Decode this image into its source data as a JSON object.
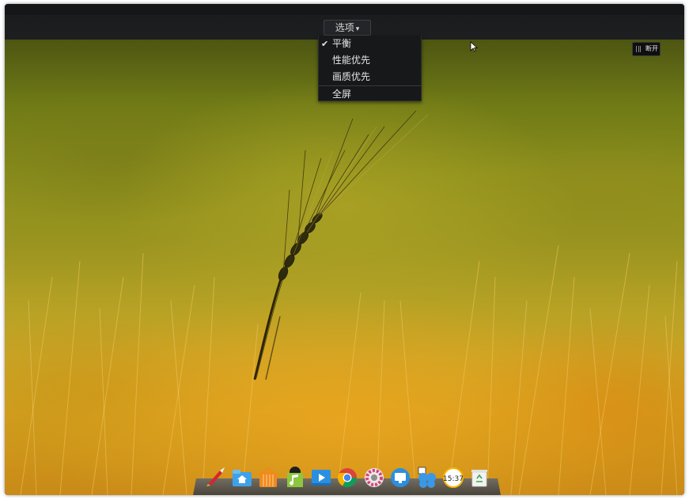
{
  "toolbar": {
    "options_label": "选项",
    "options_caret": "▾"
  },
  "options_menu": {
    "items": [
      {
        "label": "平衡",
        "checked": true
      },
      {
        "label": "性能优先",
        "checked": false
      },
      {
        "label": "画质优先",
        "checked": false
      }
    ],
    "fullscreen_label": "全屏",
    "check_glyph": "✔"
  },
  "disconnect": {
    "label": "断开"
  },
  "dock": {
    "clock_text": "15:37",
    "icons": [
      "launcher-rocket-icon",
      "file-manager-icon",
      "app-store-icon",
      "music-player-icon",
      "video-player-icon",
      "chrome-browser-icon",
      "system-settings-icon",
      "remote-desktop-icon",
      "multitask-view-icon",
      "clock-icon",
      "trash-icon"
    ]
  },
  "colors": {
    "menu_bg": "#17181a",
    "topbar_bg": "#1d1e20",
    "wallpaper_gold": "#d39f1e",
    "wallpaper_green": "#6f7a16"
  }
}
